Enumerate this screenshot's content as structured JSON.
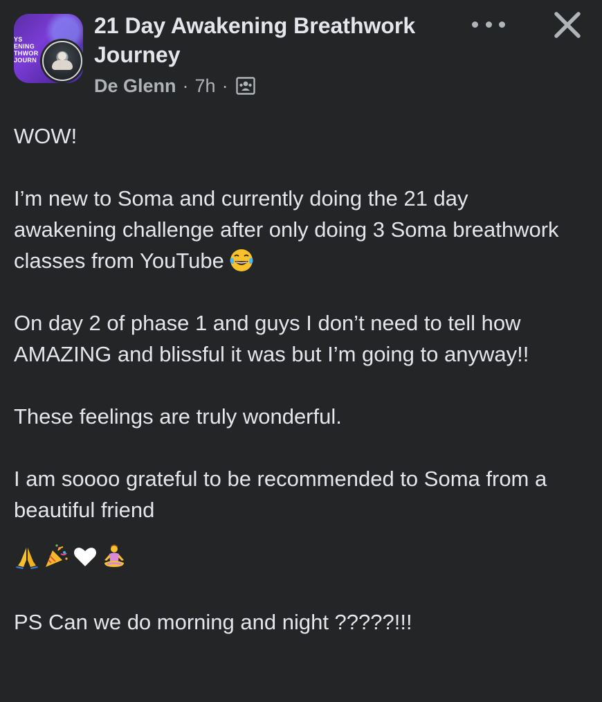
{
  "header": {
    "group_avatar_text": "YS\nENING\nTHWOR\nJOURN",
    "title": "21 Day Awakening Breathwork Journey",
    "author": "De Glenn",
    "separator": "·",
    "time": "7h",
    "privacy_icon": "members-group-icon"
  },
  "actions": {
    "more_icon": "more-dots-icon",
    "close_icon": "close-icon"
  },
  "post": {
    "p1": "WOW!",
    "p2_line": "I’m new to Soma and currently doing the 21 day awakening challenge after only doing 3 Soma breathwork classes from YouTube",
    "p2_emoji": "tears-of-joy-emoji",
    "p3": "On day 2 of phase 1 and guys I don’t need to tell how AMAZING and blissful it was but I’m going to anyway!!",
    "p4": "These feelings are truly wonderful.",
    "p5": "I am soooo grateful to be recommended to Soma from a beautiful friend",
    "emojis": [
      "folded-hands-emoji",
      "party-popper-emoji",
      "white-heart-emoji",
      "person-in-lotus-position-emoji"
    ],
    "p6": "PS Can we do morning and night ?????!!!"
  },
  "colors": {
    "background": "#242526",
    "primary_text": "#e4e6eb",
    "secondary_text": "#b0b3b8"
  }
}
